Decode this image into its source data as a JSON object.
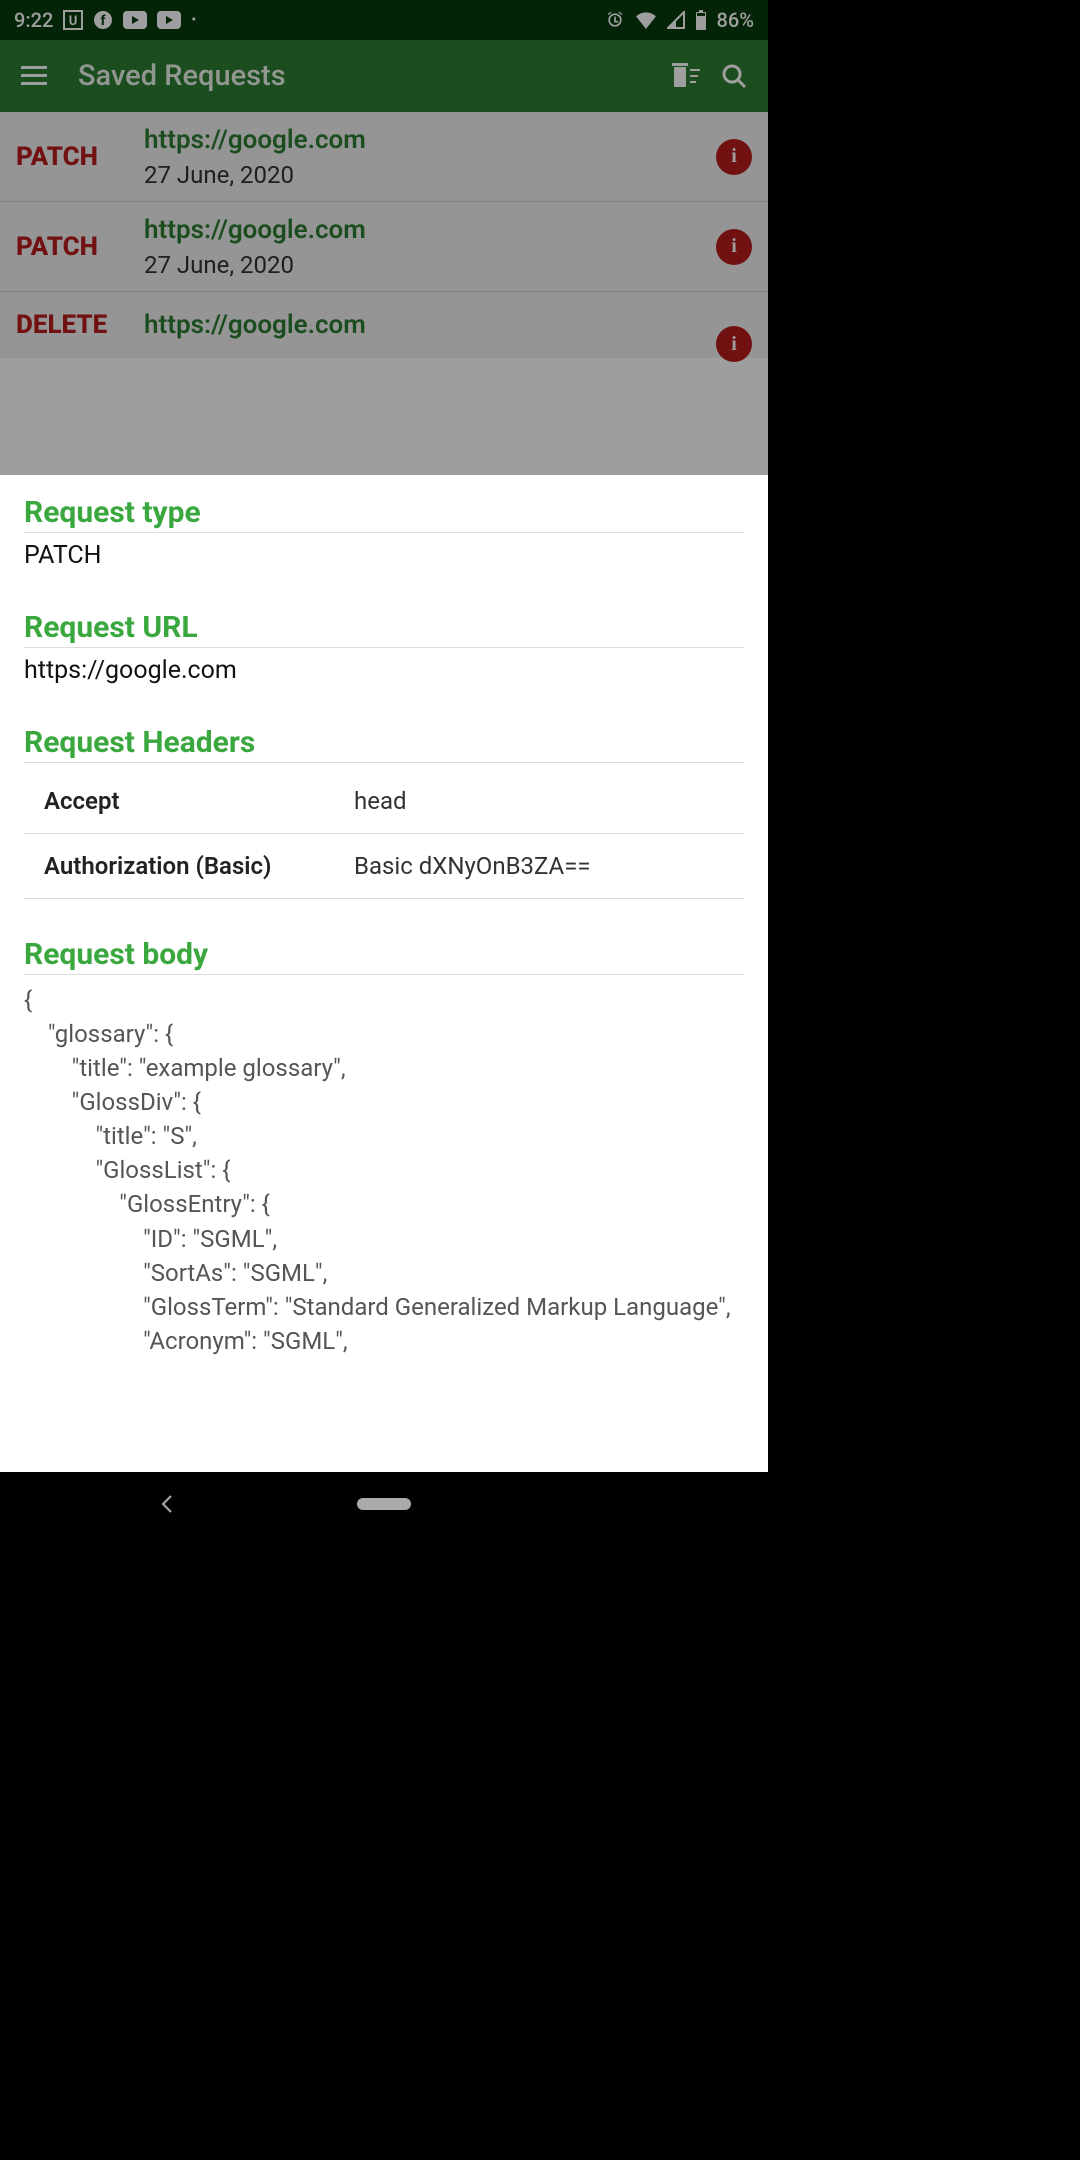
{
  "statusbar": {
    "time": "9:22",
    "battery": "86%",
    "icons": {
      "u": "U",
      "fb": "f",
      "yt1": "▶",
      "yt2": "▶",
      "dot": "•",
      "alarm": "⏰",
      "wifi": "▾",
      "signal": "◢",
      "batt": "▮"
    }
  },
  "appbar": {
    "title": "Saved Requests"
  },
  "requests": [
    {
      "method": "PATCH",
      "url": "https://google.com",
      "date": "27 June, 2020"
    },
    {
      "method": "PATCH",
      "url": "https://google.com",
      "date": "27 June, 2020"
    },
    {
      "method": "DELETE",
      "url": "https://google.com",
      "date": ""
    }
  ],
  "sheet": {
    "sections": {
      "type_label": "Request type",
      "type_value": "PATCH",
      "url_label": "Request URL",
      "url_value": "https://google.com",
      "headers_label": "Request Headers",
      "body_label": "Request body"
    },
    "headers": [
      {
        "key": "Accept",
        "value": "head"
      },
      {
        "key": "Authorization (Basic)",
        "value": "Basic dXNyOnB3ZA=="
      }
    ],
    "body": "{\n    \"glossary\": {\n        \"title\": \"example glossary\",\n        \"GlossDiv\": {\n            \"title\": \"S\",\n            \"GlossList\": {\n                \"GlossEntry\": {\n                    \"ID\": \"SGML\",\n                    \"SortAs\": \"SGML\",\n                    \"GlossTerm\": \"Standard Generalized Markup Language\",\n                    \"Acronym\": \"SGML\","
  }
}
